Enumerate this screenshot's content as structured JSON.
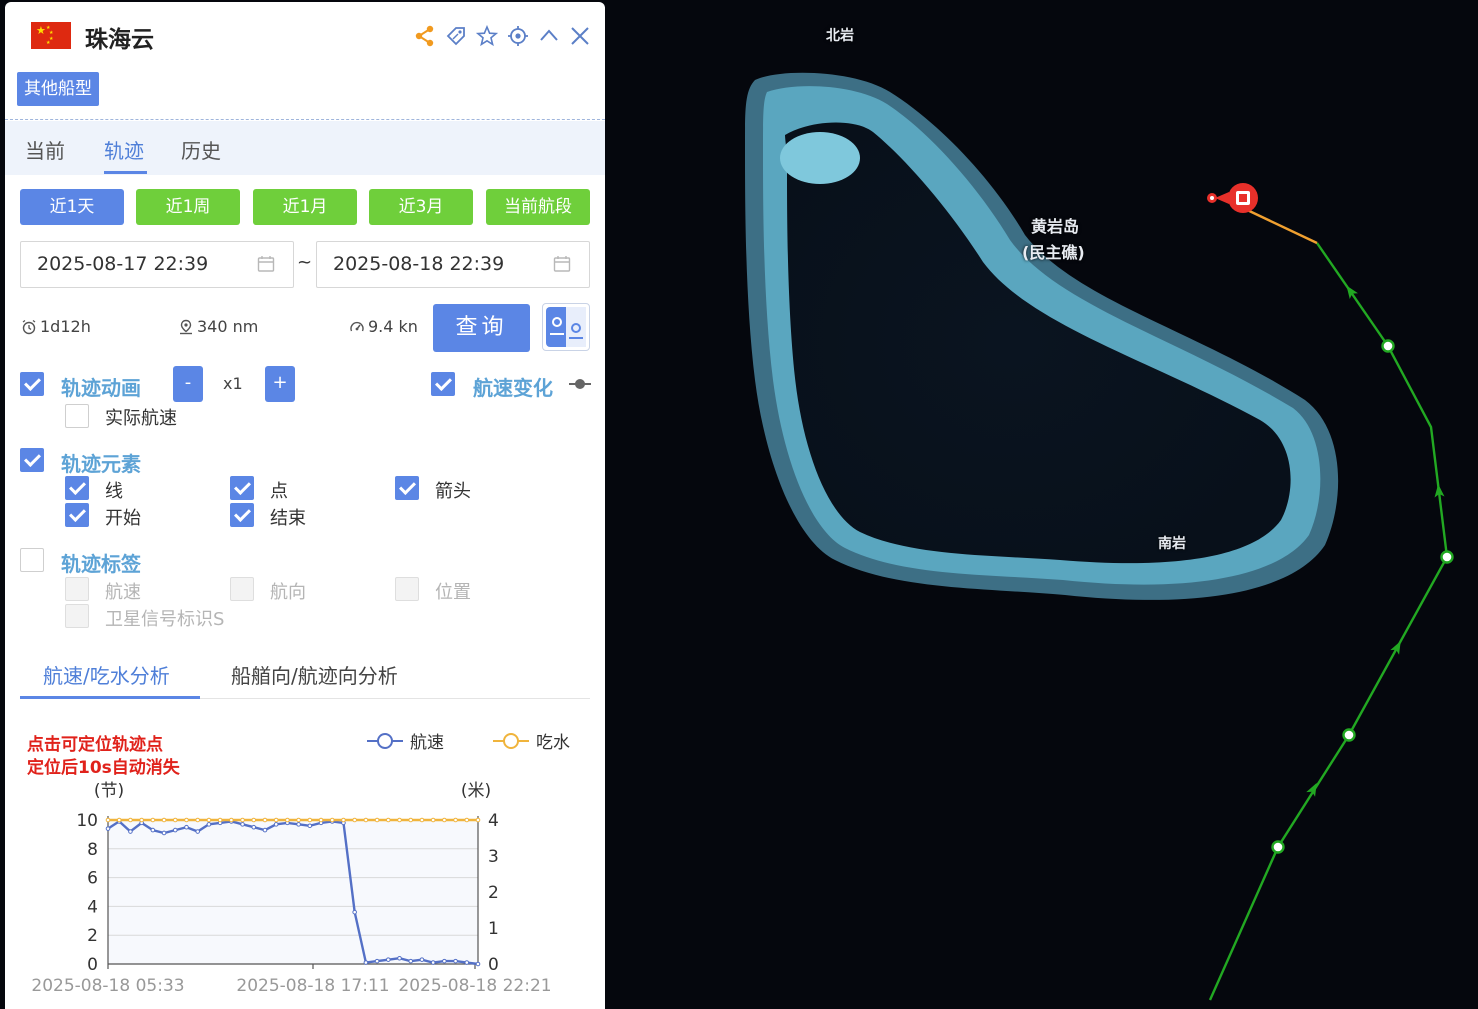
{
  "panel": {
    "ship_name": "珠海云",
    "ship_type": "其他船型",
    "header_icons": [
      "share-icon",
      "tag-icon",
      "star-icon",
      "locate-icon",
      "collapse-icon",
      "close-icon"
    ],
    "tabs": [
      {
        "label": "当前"
      },
      {
        "label": "轨迹"
      },
      {
        "label": "历史"
      }
    ],
    "active_tab": "轨迹",
    "range_buttons": [
      {
        "label": "近1天",
        "color": "#5b86e5"
      },
      {
        "label": "近1周",
        "color": "#6fcf3b"
      },
      {
        "label": "近1月",
        "color": "#6fcf3b"
      },
      {
        "label": "近3月",
        "color": "#6fcf3b"
      },
      {
        "label": "当前航段",
        "color": "#6fcf3b"
      }
    ],
    "date_start": "2025-08-17 22:39",
    "date_separator": "~",
    "date_end": "2025-08-18 22:39",
    "stats": {
      "duration": "1d12h",
      "distance": "340 nm",
      "speed": "9.4 kn"
    },
    "query_label": "查询",
    "animation": {
      "label": "轨迹动画",
      "checked": true,
      "minus": "-",
      "speed": "x1",
      "plus": "+"
    },
    "actual_speed": {
      "label": "实际航速",
      "checked": false
    },
    "speed_change": {
      "label": "航速变化",
      "checked": true
    },
    "elements": {
      "label": "轨迹元素",
      "checked": true,
      "items": [
        {
          "label": "线",
          "checked": true
        },
        {
          "label": "点",
          "checked": true
        },
        {
          "label": "箭头",
          "checked": true
        },
        {
          "label": "开始",
          "checked": true
        },
        {
          "label": "结束",
          "checked": true
        }
      ]
    },
    "labels": {
      "label": "轨迹标签",
      "checked": false,
      "items": [
        {
          "label": "航速"
        },
        {
          "label": "航向"
        },
        {
          "label": "位置"
        },
        {
          "label": "卫星信号标识S"
        }
      ]
    },
    "analysis_tabs": [
      {
        "label": "航速/吃水分析"
      },
      {
        "label": "船艏向/航迹向分析"
      }
    ],
    "hint_line1": "点击可定位轨迹点",
    "hint_line2": "定位后10s自动消失"
  },
  "chart_data": {
    "type": "line",
    "title": "",
    "ylabel_left": "(节)",
    "ylabel_right": "(米)",
    "ylim_left": [
      0,
      10
    ],
    "ylim_right": [
      0,
      4
    ],
    "yticks_left": [
      "0",
      "2",
      "4",
      "6",
      "8",
      "10"
    ],
    "yticks_right": [
      "0",
      "1",
      "2",
      "3",
      "4"
    ],
    "xtick_labels": [
      "2025-08-18 05:33",
      "2025-08-18 17:11",
      "2025-08-18 22:21"
    ],
    "legend_position": "top-right",
    "grid": true,
    "series": [
      {
        "name": "航速",
        "axis": "left",
        "color": "#5470c6",
        "values": [
          9.4,
          9.9,
          9.2,
          9.8,
          9.3,
          9.1,
          9.3,
          9.5,
          9.2,
          9.7,
          9.8,
          9.9,
          9.7,
          9.5,
          9.3,
          9.7,
          9.8,
          9.7,
          9.6,
          9.8,
          9.9,
          9.8,
          3.6,
          0.1,
          0.2,
          0.3,
          0.4,
          0.2,
          0.3,
          0.1,
          0.2,
          0.2,
          0.1,
          0.0
        ]
      },
      {
        "name": "吃水",
        "axis": "right",
        "color": "#f0b43c",
        "values": [
          4,
          4,
          4,
          4,
          4,
          4,
          4,
          4,
          4,
          4,
          4,
          4,
          4,
          4,
          4,
          4,
          4,
          4,
          4,
          4,
          4,
          4,
          4,
          4,
          4,
          4,
          4,
          4,
          4,
          4,
          4,
          4,
          4,
          4
        ]
      }
    ]
  },
  "map": {
    "labels": {
      "north_rock": "北岩",
      "island": "黄岩岛",
      "island_alt": "(民主礁)",
      "south_rock": "南岩"
    },
    "track_color": "#22a822",
    "track_end_color": "#f0a030",
    "end_marker_color": "#e8302a"
  }
}
